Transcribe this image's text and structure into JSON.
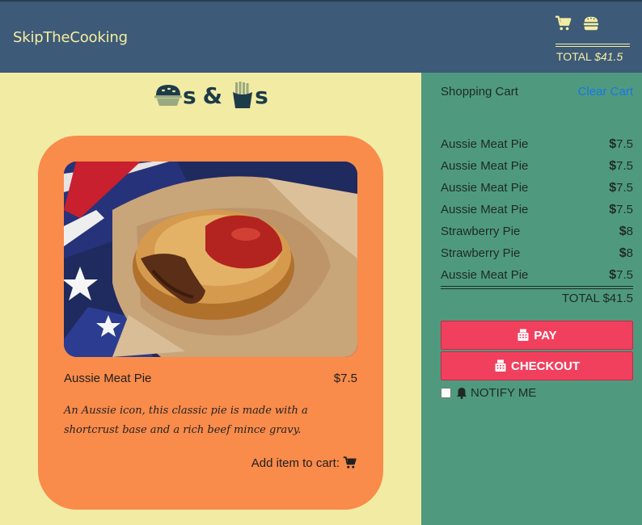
{
  "header": {
    "brand": "SkipTheCooking",
    "total_label": "TOTAL ",
    "total_amount": "$41.5",
    "icons": [
      "cart-icon",
      "burger-icon"
    ]
  },
  "main": {
    "title_word_1": "s",
    "title_amp": "&",
    "title_word_2": "s",
    "title_icons": [
      "pie-icon",
      "fries-icon"
    ],
    "item": {
      "name": "Aussie Meat Pie",
      "price": "$7.5",
      "description": "An Aussie icon, this classic pie is made with a shortcrust base and a rich beef mince gravy.",
      "add_label": "Add item to cart:"
    }
  },
  "cart": {
    "title": "Shopping Cart",
    "clear_label": "Clear Cart",
    "items": [
      {
        "name": "Aussie Meat Pie",
        "currency": "$",
        "price": "7.5"
      },
      {
        "name": "Aussie Meat Pie",
        "currency": "$",
        "price": "7.5"
      },
      {
        "name": "Aussie Meat Pie",
        "currency": "$",
        "price": "7.5"
      },
      {
        "name": "Aussie Meat Pie",
        "currency": "$",
        "price": "7.5"
      },
      {
        "name": "Strawberry Pie",
        "currency": "$",
        "price": "8"
      },
      {
        "name": "Strawberry Pie",
        "currency": "$",
        "price": "8"
      },
      {
        "name": "Aussie Meat Pie",
        "currency": "$",
        "price": "7.5"
      }
    ],
    "total": "TOTAL $41.5",
    "pay_label": "PAY",
    "checkout_label": "CHECKOUT",
    "notify_label": "NOTIFY ME",
    "notify_checked": false
  },
  "colors": {
    "header_bg": "#3d5a78",
    "header_text": "#f5eea0",
    "page_bg": "#f2eba4",
    "card_bg": "#f98b4b",
    "sidebar_bg": "#4f9a7f",
    "button_bg": "#f1405e",
    "link": "#1976e6"
  }
}
